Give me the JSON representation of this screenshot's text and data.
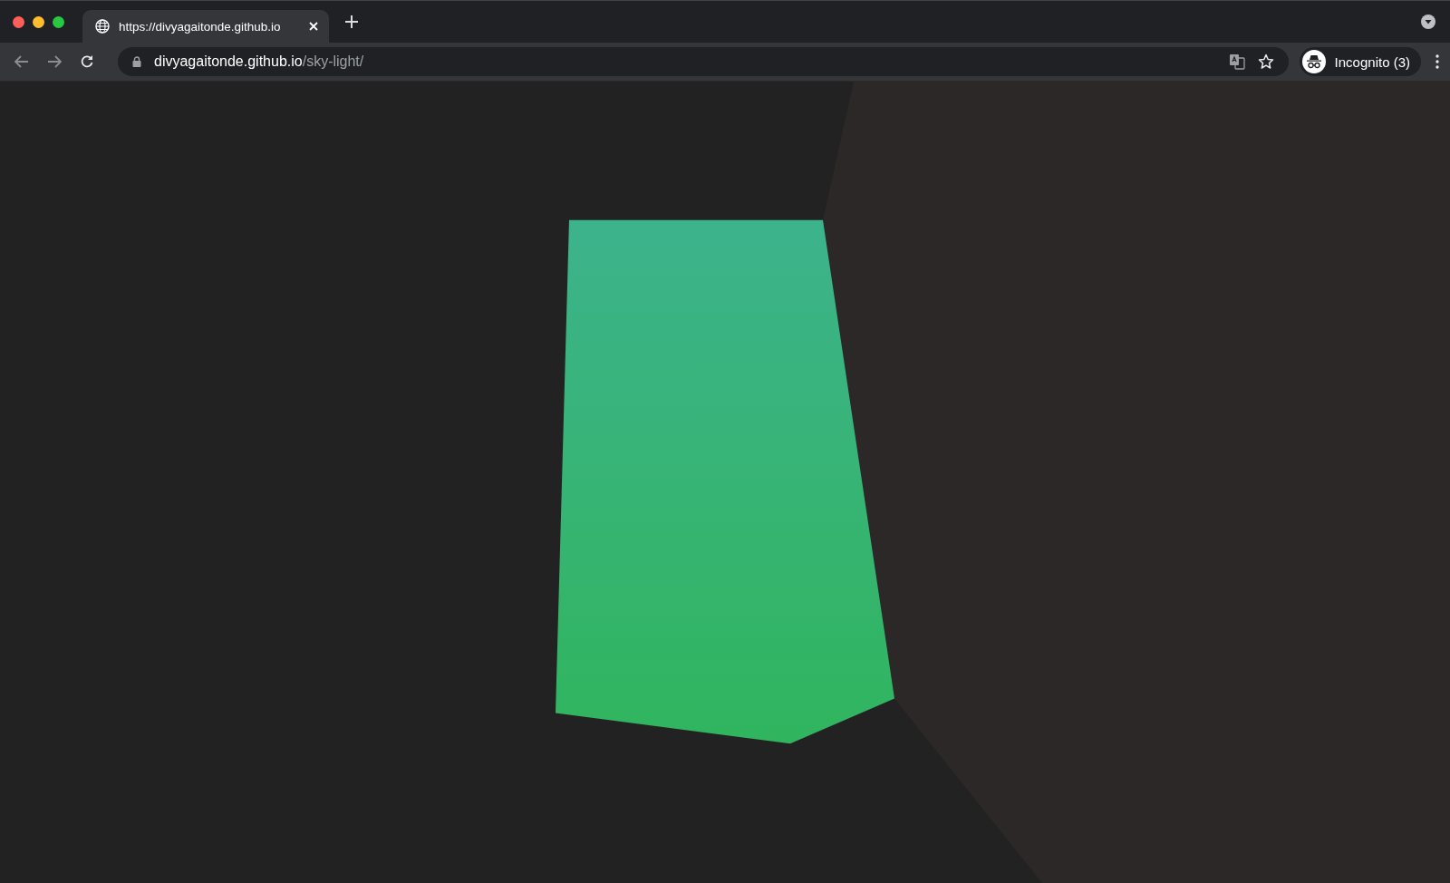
{
  "tab": {
    "title": "https://divyagaitonde.github.io",
    "selected": true
  },
  "address": {
    "host": "divyagaitonde.github.io",
    "path": "/sky-light/"
  },
  "profile": {
    "label": "Incognito (3)"
  }
}
